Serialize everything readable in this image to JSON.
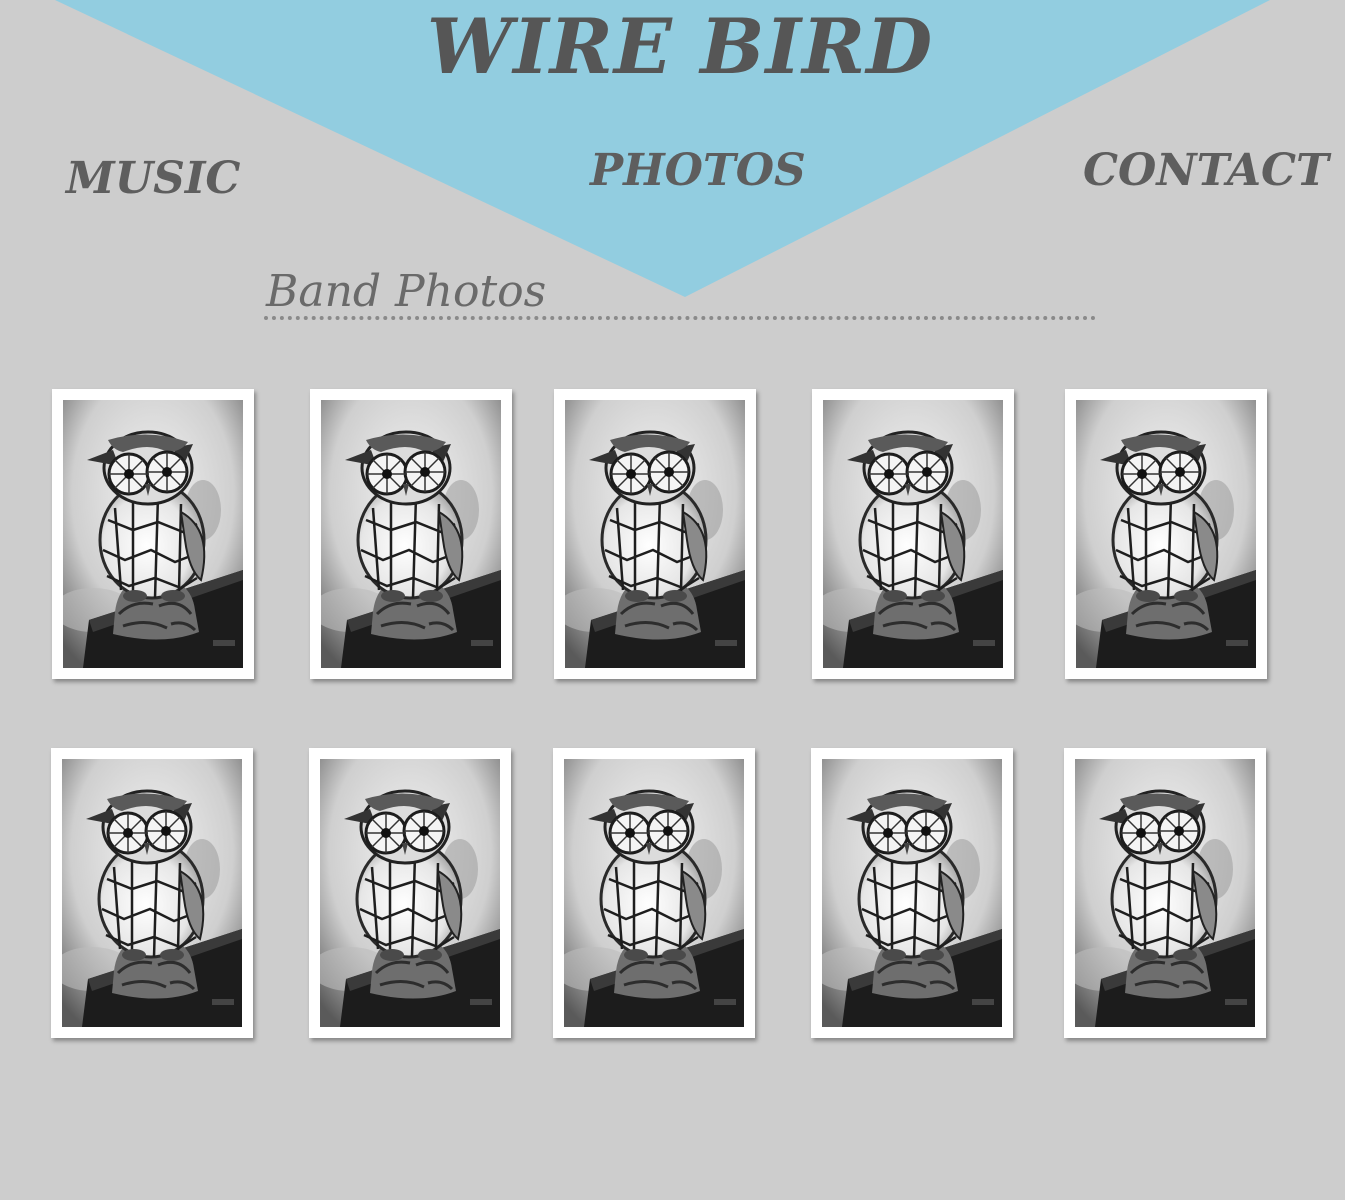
{
  "site": {
    "title": "WIRE BIRD",
    "accent_color": "#92cde0",
    "background_color": "#cdcdcd"
  },
  "nav": {
    "items": [
      {
        "label": "MUSIC",
        "id": "music"
      },
      {
        "label": "PHOTOS",
        "id": "photos"
      },
      {
        "label": "CONTACT",
        "id": "contact"
      }
    ]
  },
  "section": {
    "heading": "Band Photos"
  },
  "gallery": {
    "photos": [
      {
        "subject": "owl-figurine-photo"
      },
      {
        "subject": "owl-figurine-photo"
      },
      {
        "subject": "owl-figurine-photo"
      },
      {
        "subject": "owl-figurine-photo"
      },
      {
        "subject": "owl-figurine-photo"
      },
      {
        "subject": "owl-figurine-photo"
      },
      {
        "subject": "owl-figurine-photo"
      },
      {
        "subject": "owl-figurine-photo"
      },
      {
        "subject": "owl-figurine-photo"
      },
      {
        "subject": "owl-figurine-photo"
      }
    ]
  }
}
